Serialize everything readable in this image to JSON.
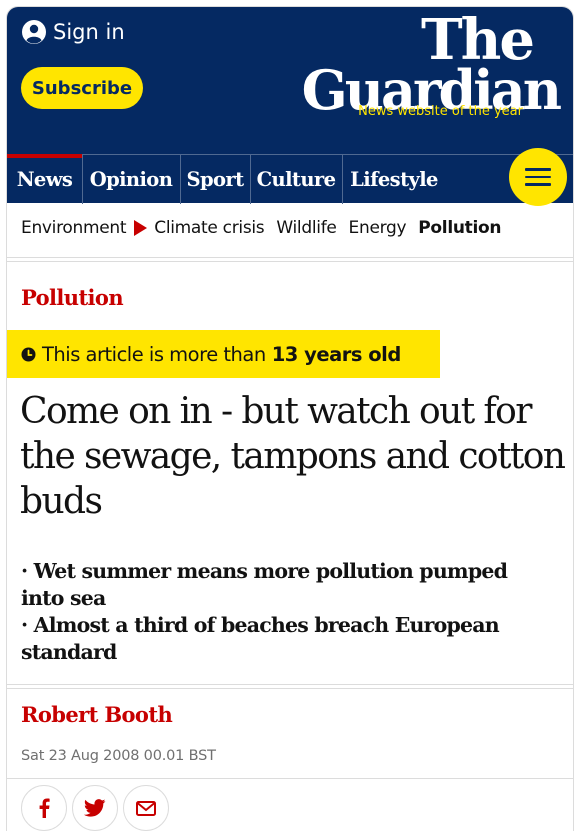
{
  "header": {
    "sign_in_label": "Sign in",
    "subscribe_label": "Subscribe",
    "logo_line1": "The",
    "logo_line2": "Guardian",
    "tagline": "News website of the year",
    "menu_icon": "hamburger-icon"
  },
  "nav": {
    "items": [
      {
        "label": "News",
        "active": true
      },
      {
        "label": "Opinion",
        "active": false
      },
      {
        "label": "Sport",
        "active": false
      },
      {
        "label": "Culture",
        "active": false
      },
      {
        "label": "Lifestyle",
        "active": false
      }
    ]
  },
  "subnav": {
    "items": [
      "Environment",
      "Climate crisis",
      "Wildlife",
      "Energy",
      "Pollution"
    ],
    "current": "Pollution"
  },
  "article": {
    "section": "Pollution",
    "age_notice_prefix": "This article is more than",
    "age_notice_bold": "13 years old",
    "headline": "Come on in - but watch out for the sewage, tampons and cotton buds",
    "standfirst": [
      "· Wet summer means more pollution pumped into sea",
      "· Almost a third of beaches breach European standard"
    ],
    "author": "Robert Booth",
    "date": "Sat 23 Aug 2008 00.01 BST"
  },
  "share": {
    "icons": [
      "facebook-icon",
      "twitter-icon",
      "email-icon"
    ]
  },
  "colors": {
    "brand_blue": "#052962",
    "brand_yellow": "#ffe500",
    "accent_red": "#c70000"
  }
}
